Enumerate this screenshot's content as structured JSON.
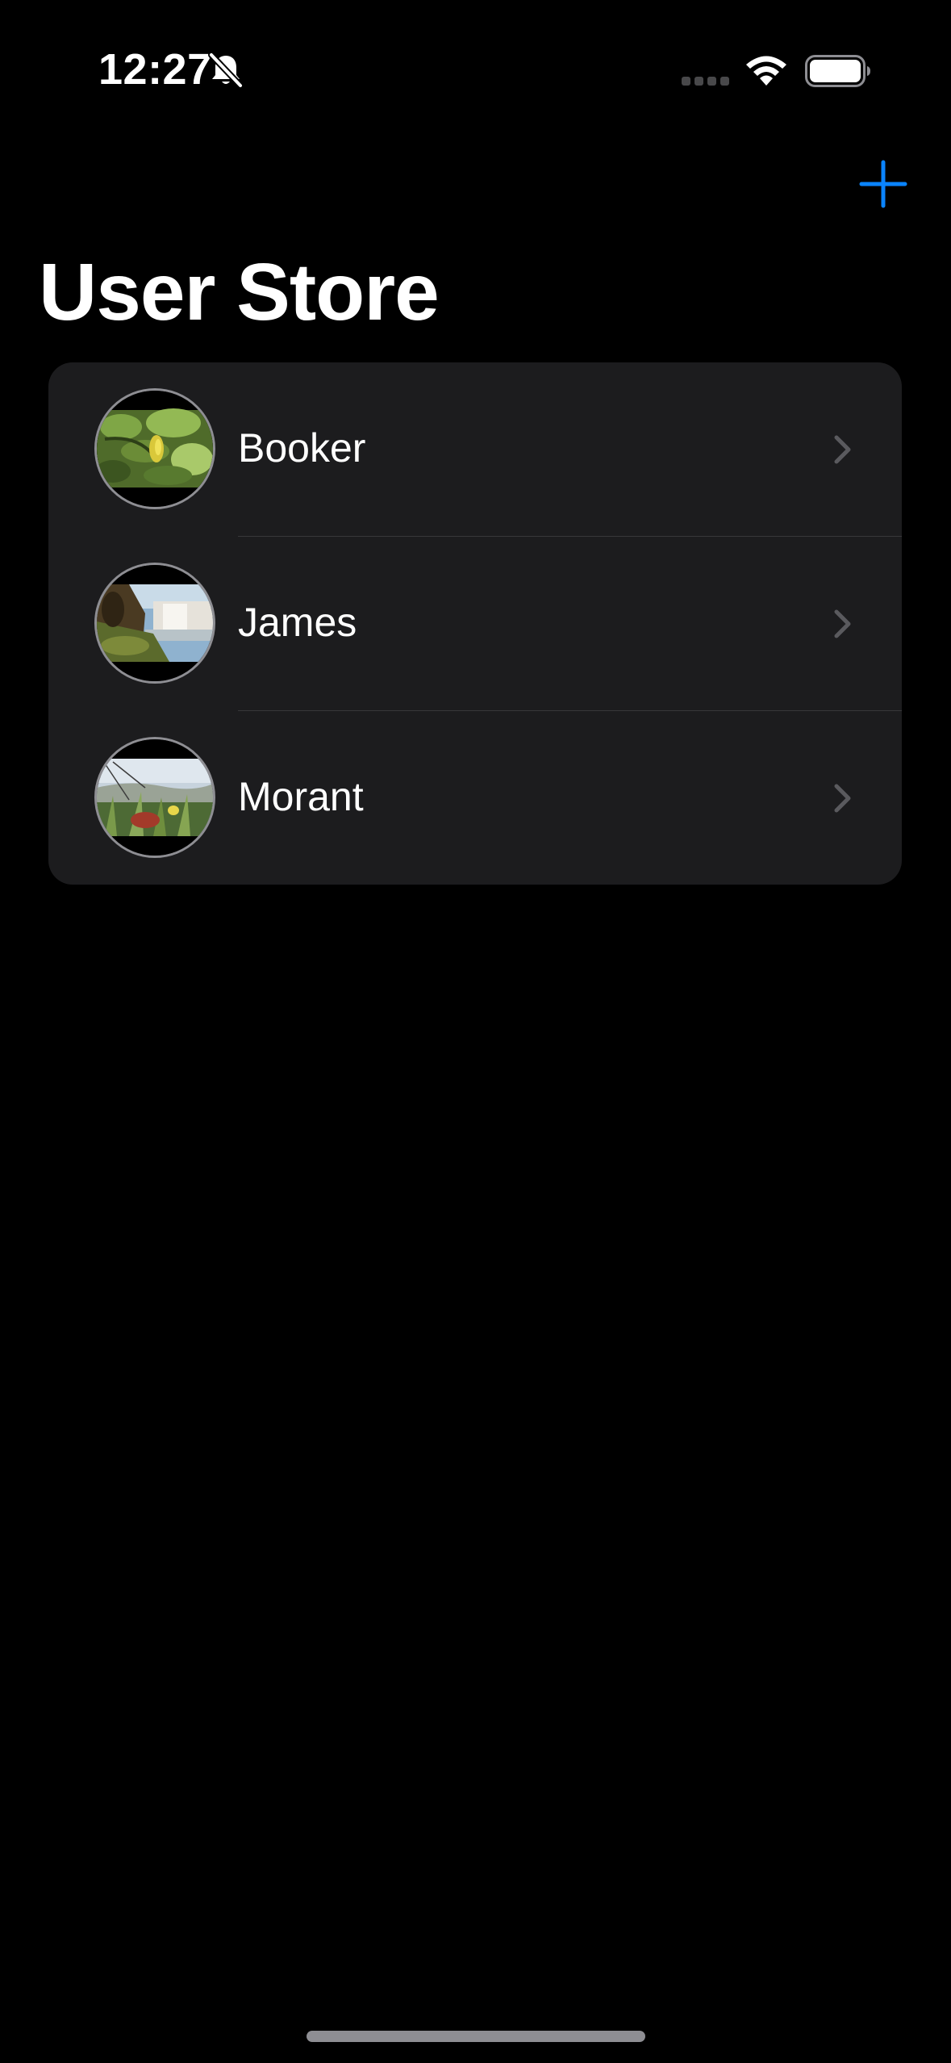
{
  "status_bar": {
    "time": "12:27",
    "icons": [
      "bell-slash-icon",
      "cellular-signal-icon",
      "wifi-icon",
      "battery-icon"
    ]
  },
  "nav": {
    "title": "User Store",
    "add_icon": "plus-icon",
    "accent_color": "#0a84ff"
  },
  "users": [
    {
      "name": "Booker",
      "avatar": "photo-leaves-fruit",
      "chevron": "chevron-right-icon"
    },
    {
      "name": "James",
      "avatar": "photo-waterfall-cliff",
      "chevron": "chevron-right-icon"
    },
    {
      "name": "Morant",
      "avatar": "photo-meadow-grass",
      "chevron": "chevron-right-icon"
    }
  ],
  "colors": {
    "background": "#000000",
    "card": "#1c1c1e",
    "separator": "#38383a",
    "chevron": "#5a5a5e",
    "text": "#ffffff"
  }
}
